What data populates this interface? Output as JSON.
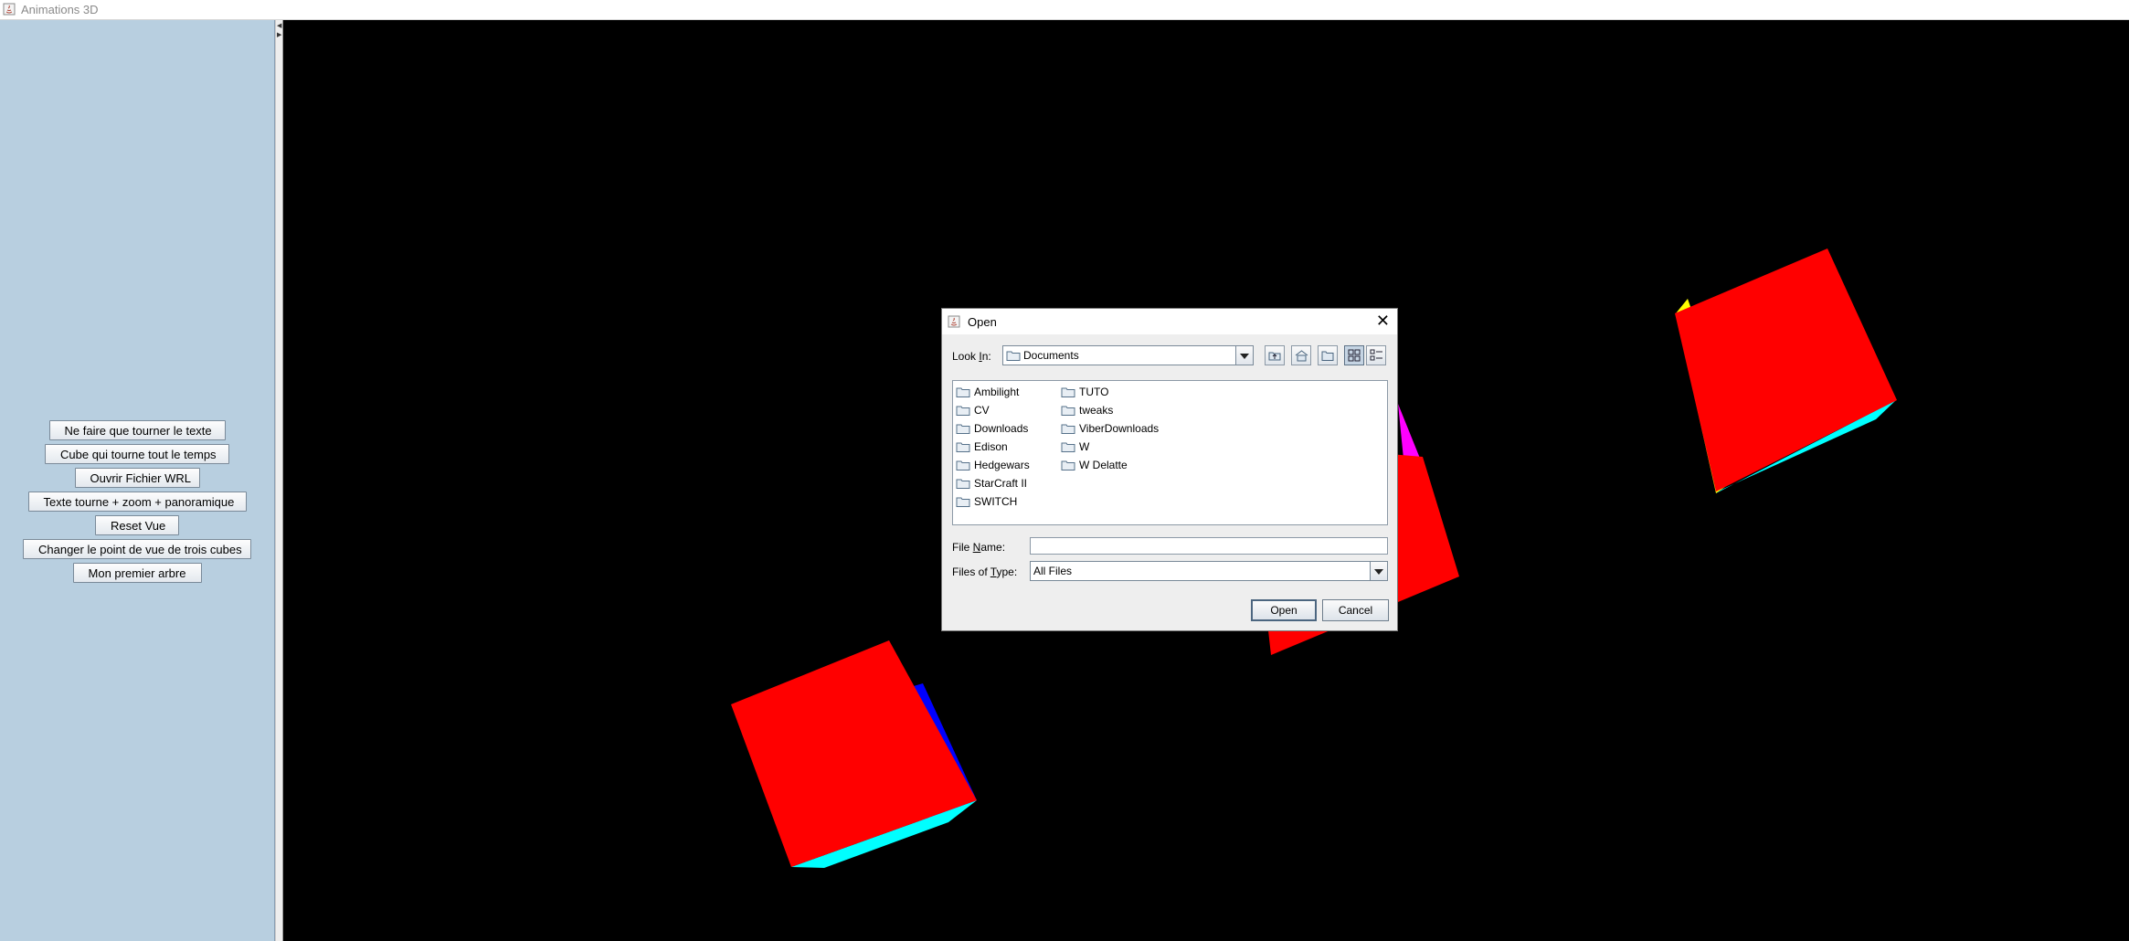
{
  "window": {
    "title": "Animations 3D"
  },
  "sidebar": {
    "buttons": [
      {
        "label": "Ne faire que tourner le texte"
      },
      {
        "label": "Cube qui tourne tout le temps"
      },
      {
        "label": "Ouvrir Fichier WRL"
      },
      {
        "label": "Texte tourne + zoom + panoramique"
      },
      {
        "label": "Reset Vue"
      },
      {
        "label": "Changer le point de vue de trois cubes"
      },
      {
        "label": "Mon premier arbre"
      }
    ]
  },
  "scene": {
    "background": "#000000",
    "face_colors": {
      "front": "#ff0000",
      "side_a": "#0000ff",
      "side_b": "#00ffff",
      "side_c": "#ffff00",
      "side_d": "#ff00ff"
    }
  },
  "dialog": {
    "title": "Open",
    "look_in": {
      "label_pre": "Look ",
      "label_key": "I",
      "label_post": "n:",
      "value": "Documents"
    },
    "toolbar_icons": [
      "up-one-level-icon",
      "home-icon",
      "new-folder-icon",
      "list-view-icon",
      "details-view-icon"
    ],
    "files_col1": [
      "Ambilight",
      "CV",
      "Downloads",
      "Edison",
      "Hedgewars",
      "StarCraft II",
      "SWITCH"
    ],
    "files_col2": [
      "TUTO",
      "tweaks",
      "ViberDownloads",
      "W",
      "W Delatte"
    ],
    "file_name": {
      "label_pre": "File ",
      "label_key": "N",
      "label_post": "ame:",
      "value": ""
    },
    "file_type": {
      "label_pre": "Files of ",
      "label_key": "T",
      "label_post": "ype:",
      "value": "All Files"
    },
    "open_label": "Open",
    "cancel_label": "Cancel"
  }
}
